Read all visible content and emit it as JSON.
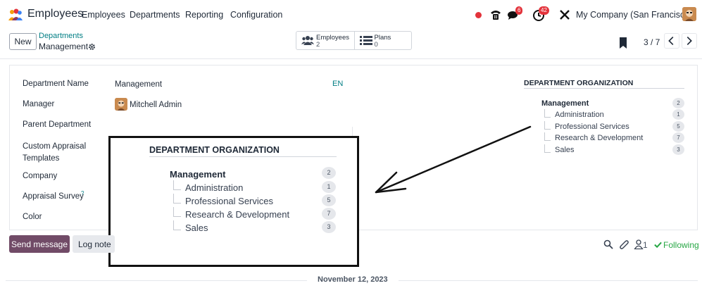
{
  "navbar": {
    "app_name": "Employees",
    "menu": [
      "Employees",
      "Departments",
      "Reporting",
      "Configuration"
    ],
    "activity_badge": "6",
    "clock_badge": "42",
    "company": "My Company (San Francisco)"
  },
  "control_panel": {
    "new_label": "New",
    "breadcrumb_parent": "Departments",
    "breadcrumb_current": "Management",
    "smart_buttons": [
      {
        "label": "Employees",
        "value": "2"
      },
      {
        "label": "Plans",
        "value": "0"
      }
    ],
    "pager": "3 / 7"
  },
  "form": {
    "fields": [
      {
        "label": "Department Name",
        "value": "Management"
      },
      {
        "label": "Manager",
        "value": "Mitchell Admin"
      },
      {
        "label": "Parent Department",
        "value": ""
      },
      {
        "label": "Custom Appraisal Templates",
        "value": ""
      },
      {
        "label": "Company",
        "value": ""
      },
      {
        "label": "Appraisal Survey",
        "value": ""
      },
      {
        "label": "Color",
        "value": ""
      }
    ],
    "lang": "EN",
    "help_mark": "?"
  },
  "org_chart": {
    "title": "DEPARTMENT ORGANIZATION",
    "root": {
      "name": "Management",
      "count": "2"
    },
    "children": [
      {
        "name": "Administration",
        "count": "1"
      },
      {
        "name": "Professional Services",
        "count": "5"
      },
      {
        "name": "Research & Development",
        "count": "7"
      },
      {
        "name": "Sales",
        "count": "3"
      }
    ]
  },
  "chatter": {
    "send_label": "Send message",
    "log_label": "Log note",
    "follower_count": "1",
    "following_label": "Following",
    "date": "November 12, 2023"
  },
  "colors": {
    "brand": "#714b67",
    "link": "#017e84",
    "badge": "#e3333b",
    "following": "#28a745"
  }
}
